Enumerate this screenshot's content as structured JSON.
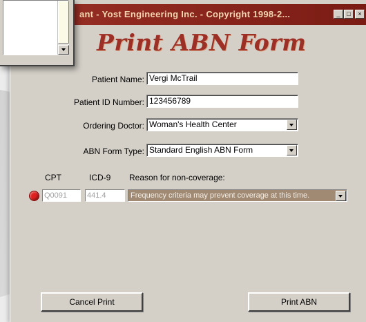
{
  "window": {
    "title": "ant - Yost Engineering Inc. - Copyright 1998-2...",
    "heading": "Print ABN Form",
    "minimize_glyph": "_",
    "maximize_glyph": "□",
    "close_glyph": "×"
  },
  "form": {
    "patient_name": {
      "label": "Patient Name:",
      "value": "Vergi McTrail"
    },
    "patient_id": {
      "label": "Patient ID Number:",
      "value": "123456789"
    },
    "ordering_doctor": {
      "label": "Ordering Doctor:",
      "value": "Woman's Health Center"
    },
    "abn_form_type": {
      "label": "ABN Form Type:",
      "value": "Standard English ABN Form"
    }
  },
  "table": {
    "headers": {
      "cpt": "CPT",
      "icd9": "ICD-9",
      "reason": "Reason for non-coverage:"
    },
    "rows": [
      {
        "cpt": "Q0091",
        "icd9": "441.4",
        "reason": "Frequency criteria may prevent coverage at this time."
      }
    ]
  },
  "buttons": {
    "cancel": "Cancel Print",
    "print": "Print ABN"
  },
  "colors": {
    "titlebar": "#9a3026",
    "heading": "#9c2f26",
    "status_dot": "#e02020",
    "reason_bg": "#a08a74"
  },
  "icons": {
    "status": "red-dot-icon",
    "dropdown": "chevron-down-icon"
  }
}
